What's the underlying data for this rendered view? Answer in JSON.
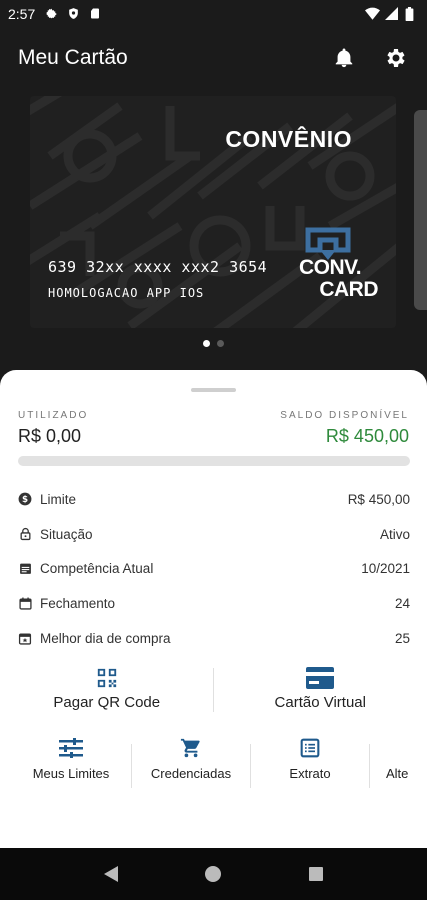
{
  "status_bar": {
    "time": "2:57",
    "left_icons": [
      "gear-icon",
      "shield-icon",
      "sd-card-icon"
    ],
    "right_icons": [
      "wifi-icon",
      "signal-icon",
      "battery-icon"
    ]
  },
  "app_bar": {
    "title": "Meu Cartão",
    "actions": [
      "bell-icon",
      "gear-icon"
    ]
  },
  "card": {
    "title": "CONVÊNIO",
    "number": "639 32xx xxxx xxx2 3654",
    "holder": "HOMOLOGACAO APP IOS",
    "logo_text_top": "CONV.",
    "logo_text_bottom": "CARD",
    "logo_color": "#3d6fa0",
    "pages": 2,
    "active_page": 0
  },
  "balance": {
    "used_label": "UTILIZADO",
    "used_value": "R$  0,00",
    "available_label": "SALDO DISPONÍVEL",
    "available_value": "R$  450,00",
    "used_fraction": 0.0,
    "available_color": "#2f8a3c"
  },
  "info": [
    {
      "icon": "dollar-circle-icon",
      "label": "Limite",
      "value": "R$  450,00"
    },
    {
      "icon": "lock-icon",
      "label": "Situação",
      "value": "Ativo"
    },
    {
      "icon": "calendar-list-icon",
      "label": "Competência Atual",
      "value": "10/2021"
    },
    {
      "icon": "calendar-icon",
      "label": "Fechamento",
      "value": "24"
    },
    {
      "icon": "calendar-star-icon",
      "label": "Melhor dia de compra",
      "value": "25"
    }
  ],
  "primary_actions": [
    {
      "icon": "qr-code-icon",
      "label": "Pagar QR Code"
    },
    {
      "icon": "credit-card-icon",
      "label": "Cartão Virtual"
    }
  ],
  "secondary_actions": [
    {
      "icon": "sliders-icon",
      "label": "Meus Limites"
    },
    {
      "icon": "shopping-cart-icon",
      "label": "Credenciadas"
    },
    {
      "icon": "statement-icon",
      "label": "Extrato"
    },
    {
      "icon": "more-icon",
      "label": "Alte"
    }
  ],
  "nav_bar": [
    "back-icon",
    "home-icon",
    "recents-icon"
  ],
  "accent_blue": "#1f5a8c"
}
